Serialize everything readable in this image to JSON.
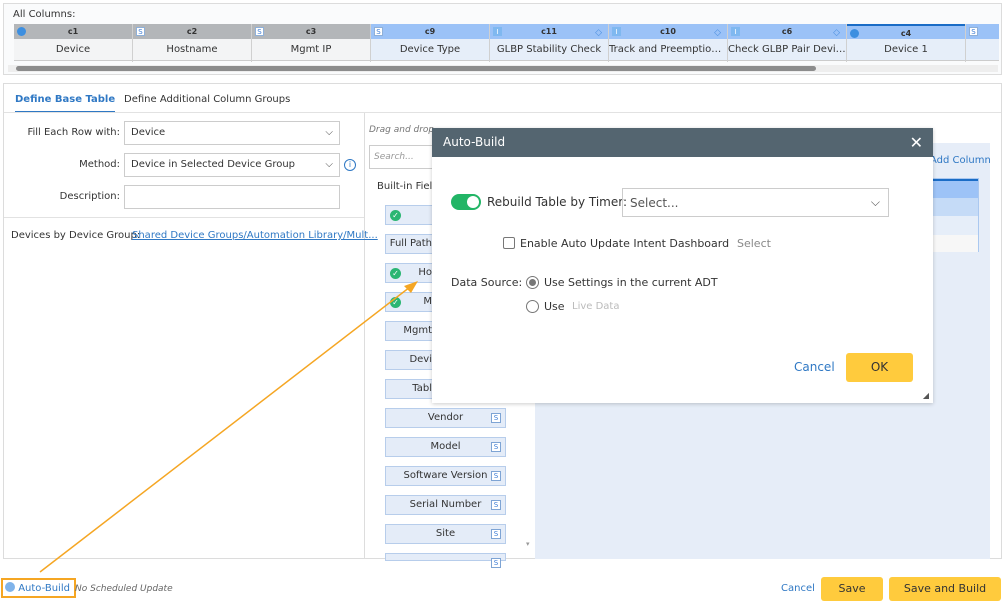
{
  "all_columns": {
    "label": "All Columns:",
    "columns": [
      {
        "code": "c1",
        "name": "Device",
        "icon": "device-icon"
      },
      {
        "code": "c2",
        "name": "Hostname",
        "icon": "S"
      },
      {
        "code": "c3",
        "name": "Mgmt IP",
        "icon": "S"
      },
      {
        "code": "c9",
        "name": "Device Type",
        "icon": "S"
      },
      {
        "code": "c11",
        "name": "GLBP Stability Check",
        "icon": "I"
      },
      {
        "code": "c10",
        "name": "Track and Preemption ...",
        "icon": "I"
      },
      {
        "code": "c6",
        "name": "Check GLBP Pair Device",
        "icon": "I"
      },
      {
        "code": "c4",
        "name": "Device 1",
        "icon": "device-icon"
      },
      {
        "code": "",
        "name": "",
        "icon": "S"
      }
    ]
  },
  "tabs": [
    "Define Base Table",
    "Define Additional Column Groups"
  ],
  "form": {
    "fill_label": "Fill Each Row with:",
    "fill_value": "Device",
    "method_label": "Method:",
    "method_value": "Device in Selected Device Group",
    "description_label": "Description:",
    "description_value": "",
    "group_label": "Devices by Device Group:",
    "group_link": "Shared Device Groups/Automation Library/Mult..."
  },
  "fields": {
    "hint": "Drag and drop",
    "search_placeholder": "Search...",
    "builtin_label": "Built-in Field",
    "items": [
      {
        "label": "",
        "check": true
      },
      {
        "label": "Full Path",
        "check": false
      },
      {
        "label": "Ho",
        "check": true
      },
      {
        "label": "M",
        "check": true
      },
      {
        "label": "Mgmt",
        "check": false
      },
      {
        "label": "Devi",
        "check": false
      },
      {
        "label": "Tabl",
        "check": false
      },
      {
        "label": "Vendor",
        "s": true
      },
      {
        "label": "Model",
        "s": true
      },
      {
        "label": "Software Version",
        "s": true
      },
      {
        "label": "Serial Number",
        "s": true
      },
      {
        "label": "Site",
        "s": true
      },
      {
        "label": "",
        "s": true
      }
    ]
  },
  "add_column": "Add Column",
  "dialog": {
    "title": "Auto-Build",
    "timer_label": "Rebuild Table by Timer:",
    "timer_toggle": true,
    "timer_placeholder": "Select...",
    "auto_update_label": "Enable Auto Update Intent Dashboard",
    "auto_update_select": "Select",
    "data_source_label": "Data Source:",
    "option1": "Use Settings in the current ADT",
    "option2": "Use",
    "option2_value": "Live Data",
    "cancel": "Cancel",
    "ok": "OK"
  },
  "footer": {
    "auto_build": "Auto-Build",
    "schedule": "No Scheduled Update",
    "cancel": "Cancel",
    "save": "Save",
    "save_build": "Save and Build"
  },
  "colors": {
    "accent": "#2f78c4",
    "button": "#ffcb3d",
    "dialog_header": "#546570",
    "annotation": "#f5a623"
  }
}
